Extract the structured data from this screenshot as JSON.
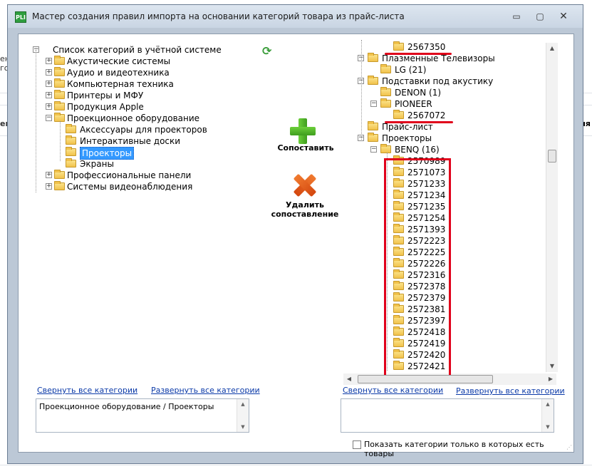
{
  "window": {
    "app_icon_text": "PLI",
    "title": "Мастер создания правил импорта на основании категорий товара из прайс-листа",
    "minimize": "▭",
    "maximize": "▢",
    "close": "✕"
  },
  "background": {
    "left_snippets": [
      "ен",
      "го",
      "ен"
    ],
    "right_snippet": "ня"
  },
  "left_tree": {
    "root_label": "Список категорий в учётной системе",
    "items": [
      {
        "label": "Акустические системы",
        "expander": "+"
      },
      {
        "label": "Аудио и видеотехника",
        "expander": "+"
      },
      {
        "label": "Компьютерная техника",
        "expander": "+"
      },
      {
        "label": "Принтеры и МФУ",
        "expander": "+"
      },
      {
        "label": "Продукция Apple",
        "expander": "+"
      },
      {
        "label": "Проекционное оборудование",
        "expander": "−"
      },
      {
        "label": "Аксессуары для проекторов",
        "expander": ""
      },
      {
        "label": "Интерактивные доски",
        "expander": ""
      },
      {
        "label": "Проекторы",
        "expander": "",
        "selected": true
      },
      {
        "label": "Экраны",
        "expander": ""
      },
      {
        "label": "Профессиональные панели",
        "expander": "+"
      },
      {
        "label": "Системы видеонаблюдения",
        "expander": "+"
      }
    ]
  },
  "actions": {
    "match_label": "Сопоставить",
    "delete_label_line1": "Удалить",
    "delete_label_line2": "сопоставление"
  },
  "right_tree": {
    "items": [
      {
        "label": "2567350",
        "expander": ""
      },
      {
        "label": "Плазменные Телевизоры",
        "expander": "−"
      },
      {
        "label": "LG (21)",
        "expander": ""
      },
      {
        "label": "Подставки под акустику",
        "expander": "−"
      },
      {
        "label": "DENON (1)",
        "expander": ""
      },
      {
        "label": "PIONEER",
        "expander": "−"
      },
      {
        "label": "2567072",
        "expander": ""
      },
      {
        "label": "Прайс-лист",
        "expander": ""
      },
      {
        "label": "Проекторы",
        "expander": "−"
      },
      {
        "label": "BENQ (16)",
        "expander": "−"
      },
      {
        "label": "2570989",
        "expander": ""
      },
      {
        "label": "2571073",
        "expander": ""
      },
      {
        "label": "2571233",
        "expander": ""
      },
      {
        "label": "2571234",
        "expander": ""
      },
      {
        "label": "2571235",
        "expander": ""
      },
      {
        "label": "2571254",
        "expander": ""
      },
      {
        "label": "2571393",
        "expander": ""
      },
      {
        "label": "2572223",
        "expander": ""
      },
      {
        "label": "2572225",
        "expander": ""
      },
      {
        "label": "2572226",
        "expander": ""
      },
      {
        "label": "2572316",
        "expander": ""
      },
      {
        "label": "2572378",
        "expander": ""
      },
      {
        "label": "2572379",
        "expander": ""
      },
      {
        "label": "2572381",
        "expander": ""
      },
      {
        "label": "2572397",
        "expander": ""
      },
      {
        "label": "2572418",
        "expander": ""
      },
      {
        "label": "2572419",
        "expander": ""
      },
      {
        "label": "2572420",
        "expander": ""
      },
      {
        "label": "2572421",
        "expander": ""
      }
    ]
  },
  "left_links": {
    "collapse": "Свернуть все категории",
    "expand": "Развернуть все категории"
  },
  "right_links": {
    "collapse": "Свернуть все категории",
    "expand": "Развернуть все категории"
  },
  "left_path_box": "Проекционное оборудование / Проекторы",
  "right_path_box": "",
  "show_only_with_goods": {
    "label": "Показать категории только в которых есть товары",
    "checked": false
  },
  "colors": {
    "annotation": "#e0001b",
    "selection": "#3399ff",
    "link": "#0b3aa8"
  }
}
